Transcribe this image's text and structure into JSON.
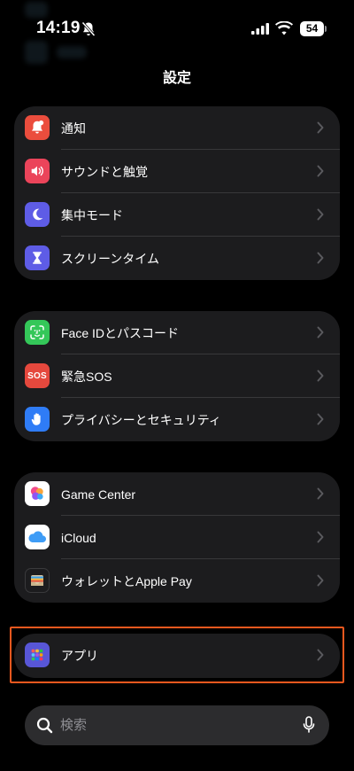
{
  "status": {
    "time": "14:19",
    "battery": "54"
  },
  "nav": {
    "title": "設定"
  },
  "groups": [
    {
      "items": [
        {
          "label": "通知",
          "icon": "bell-icon",
          "color": "#eb4d3d"
        },
        {
          "label": "サウンドと触覚",
          "icon": "speaker-icon",
          "color": "#eb445a"
        },
        {
          "label": "集中モード",
          "icon": "moon-icon",
          "color": "#5e5ce6"
        },
        {
          "label": "スクリーンタイム",
          "icon": "hourglass-icon",
          "color": "#5e5ce6"
        }
      ]
    },
    {
      "items": [
        {
          "label": "Face IDとパスコード",
          "icon": "faceid-icon",
          "color": "#34c759"
        },
        {
          "label": "緊急SOS",
          "icon": "sos-icon",
          "color": "#e5483d"
        },
        {
          "label": "プライバシーとセキュリティ",
          "icon": "hand-icon",
          "color": "#2f7cf6"
        }
      ]
    },
    {
      "items": [
        {
          "label": "Game Center",
          "icon": "game-center-icon",
          "color": "#ffffff"
        },
        {
          "label": "iCloud",
          "icon": "icloud-icon",
          "color": "#ffffff"
        },
        {
          "label": "ウォレットとApple Pay",
          "icon": "wallet-icon",
          "color": "#1c1c1e"
        }
      ]
    },
    {
      "items": [
        {
          "label": "アプリ",
          "icon": "apps-icon",
          "color": "#5856d6"
        }
      ]
    }
  ],
  "search": {
    "placeholder": "検索"
  }
}
